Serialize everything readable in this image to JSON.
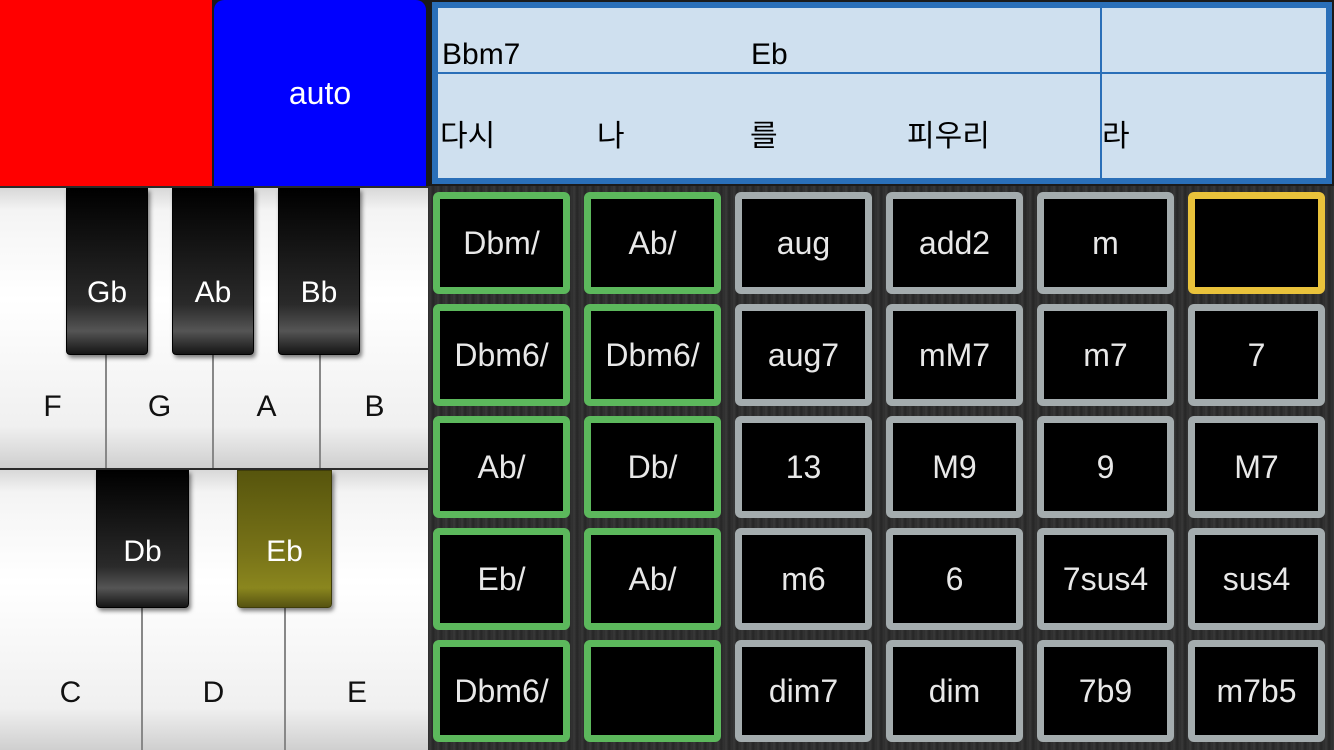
{
  "top_controls": {
    "auto_label": "auto"
  },
  "piano": {
    "upper_white": [
      "F",
      "G",
      "A",
      "B"
    ],
    "upper_black": [
      "Gb",
      "Ab",
      "Bb"
    ],
    "lower_white": [
      "C",
      "D",
      "E"
    ],
    "lower_black": [
      "Db",
      "Eb"
    ],
    "active_key": "Eb"
  },
  "lyrics": {
    "chords": [
      "Bbm7",
      "Eb"
    ],
    "words": [
      "다시",
      "나",
      "를",
      "피우리",
      "라"
    ]
  },
  "chord_grid": {
    "rows": [
      [
        {
          "label": "Dbm/",
          "style": "green"
        },
        {
          "label": "Ab/",
          "style": "green"
        },
        {
          "label": "aug",
          "style": "gray"
        },
        {
          "label": "add2",
          "style": "gray"
        },
        {
          "label": "m",
          "style": "gray"
        },
        {
          "label": "",
          "style": "yellow"
        }
      ],
      [
        {
          "label": "Dbm6/",
          "style": "green"
        },
        {
          "label": "Dbm6/",
          "style": "green"
        },
        {
          "label": "aug7",
          "style": "gray"
        },
        {
          "label": "mM7",
          "style": "gray"
        },
        {
          "label": "m7",
          "style": "gray"
        },
        {
          "label": "7",
          "style": "gray"
        }
      ],
      [
        {
          "label": "Ab/",
          "style": "green"
        },
        {
          "label": "Db/",
          "style": "green"
        },
        {
          "label": "13",
          "style": "gray"
        },
        {
          "label": "M9",
          "style": "gray"
        },
        {
          "label": "9",
          "style": "gray"
        },
        {
          "label": "M7",
          "style": "gray"
        }
      ],
      [
        {
          "label": "Eb/",
          "style": "green"
        },
        {
          "label": "Ab/",
          "style": "green"
        },
        {
          "label": "m6",
          "style": "gray"
        },
        {
          "label": "6",
          "style": "gray"
        },
        {
          "label": "7sus4",
          "style": "gray"
        },
        {
          "label": "sus4",
          "style": "gray"
        }
      ],
      [
        {
          "label": "Dbm6/",
          "style": "green"
        },
        {
          "label": "",
          "style": "green"
        },
        {
          "label": "dim7",
          "style": "gray"
        },
        {
          "label": "dim",
          "style": "gray"
        },
        {
          "label": "7b9",
          "style": "gray"
        },
        {
          "label": "m7b5",
          "style": "gray"
        }
      ]
    ]
  },
  "colors": {
    "red_pad": "#ff0000",
    "auto_button": "#0000ff",
    "lyric_background": "#cfe0ef",
    "lyric_border": "#2a6fb8",
    "green_border": "#5cb85c",
    "gray_border": "#a4acae",
    "yellow_border": "#e9c23b",
    "active_key": "#787318"
  }
}
